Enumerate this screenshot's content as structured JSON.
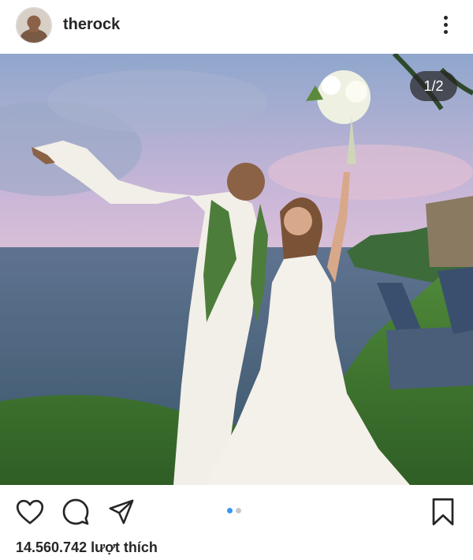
{
  "post_header": {
    "username": "therock",
    "avatar_icon": "profile-photo",
    "more_icon": "more-options-icon"
  },
  "photo": {
    "counter_text": "1/2",
    "description_icon": "wedding-photo"
  },
  "actions": {
    "like_icon": "heart-icon",
    "comment_icon": "comment-icon",
    "share_icon": "paper-plane-icon",
    "save_icon": "bookmark-icon",
    "carousel": {
      "total": 2,
      "active_index": 0,
      "active_color": "#3897f0",
      "inactive_color": "#c7c7c7"
    }
  },
  "likes": {
    "text": "14.560.742 lượt thích"
  }
}
